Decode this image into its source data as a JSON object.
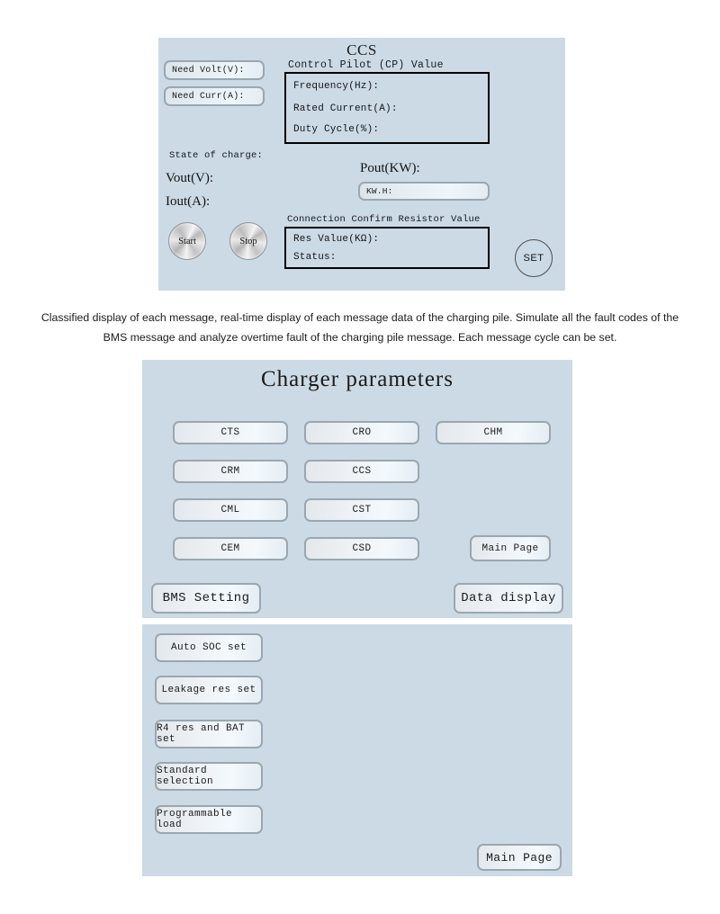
{
  "ccs_panel": {
    "title": "CCS",
    "cp_section_label": "Control Pilot (CP) Value",
    "cp_rows": [
      "Frequency(Hz):",
      "Rated Current(A):",
      "Duty Cycle(%):"
    ],
    "need_volt": "Need Volt(V):",
    "need_curr": "Need Curr(A):",
    "state_of_charge": "State of charge:",
    "vout": "Vout(V):",
    "iout": "Iout(A):",
    "pout": "Pout(KW):",
    "kwh": "KW.H:",
    "start_button": "Start",
    "stop_button": "Stop",
    "set_button": "SET",
    "resistor_section_label": "Connection Confirm Resistor Value",
    "resistor_rows": [
      "Res Value(KΩ):",
      "Status:"
    ]
  },
  "caption": {
    "text": "Classified display of each message, real-time display of each message data of the charging pile. Simulate all the fault codes of the BMS message and analyze overtime fault of the charging pile message. Each message cycle can be set."
  },
  "charger_parameters_panel": {
    "title": "Charger parameters",
    "message_buttons": [
      "CTS",
      "CRO",
      "CHM",
      "CRM",
      "CCS",
      "CML",
      "CST",
      "CEM",
      "CSD"
    ],
    "main_page_button": "Main Page",
    "bms_setting_button": "BMS Setting",
    "data_display_button": "Data display"
  },
  "settings_panel": {
    "items": [
      "Auto SOC set",
      "Leakage res set",
      "R4 res and BAT set",
      "Standard selection",
      "Programmable load"
    ],
    "main_page_button": "Main Page"
  },
  "colors": {
    "panel_background": "#ccdae5",
    "button_border": "#9aa7b0",
    "box_border": "#000000",
    "text": "#1a1a1a",
    "page_background": "#ffffff"
  }
}
